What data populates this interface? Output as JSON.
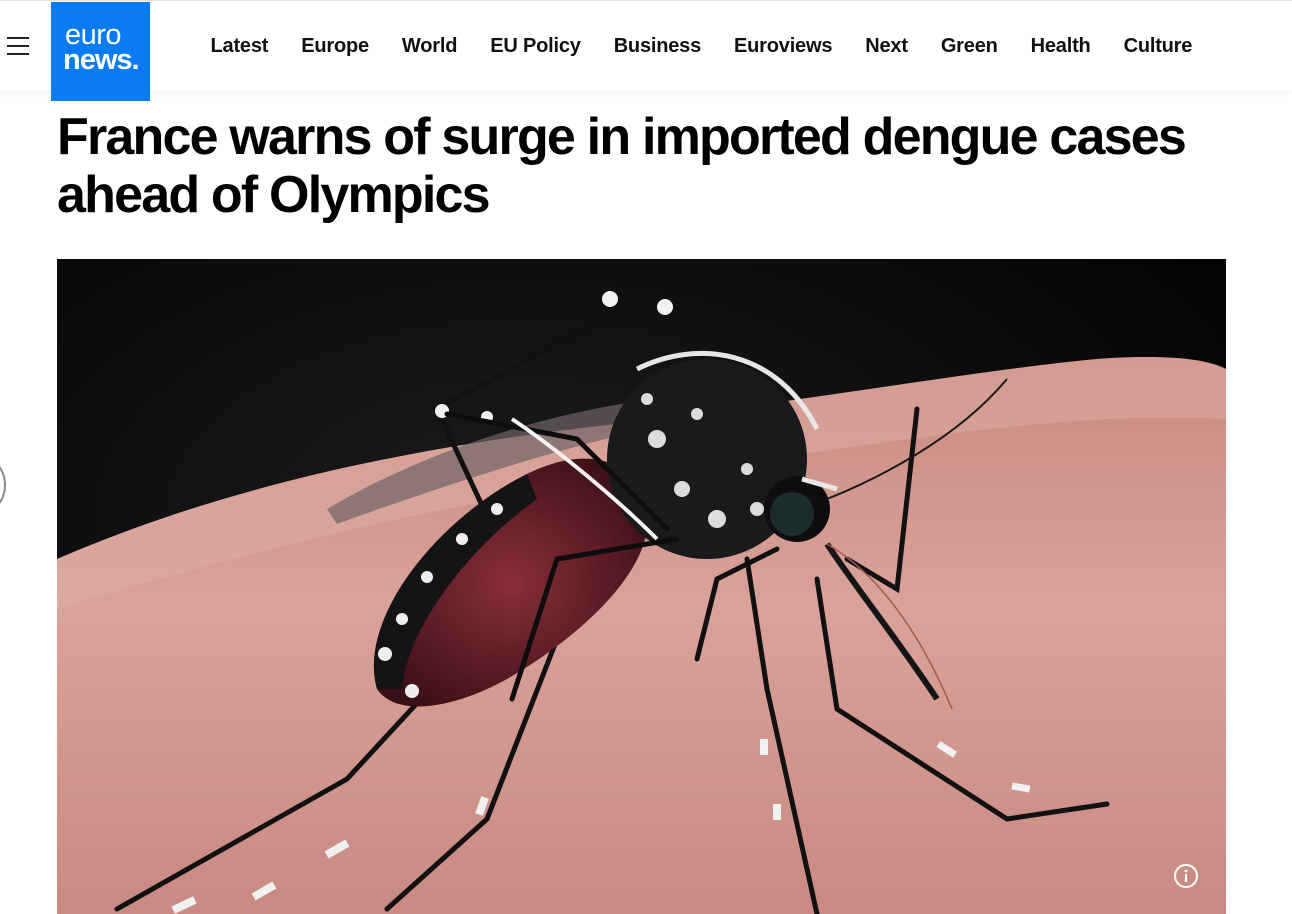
{
  "header": {
    "logo": {
      "line1": "euro",
      "line2": "news."
    },
    "menu_icon": "hamburger-icon",
    "nav": [
      "Latest",
      "Europe",
      "World",
      "EU Policy",
      "Business",
      "Euroviews",
      "Next",
      "Green",
      "Health",
      "Culture"
    ]
  },
  "article": {
    "headline": "France warns of surge in imported dengue cases ahead of Olympics"
  },
  "hero": {
    "info_icon": "info-icon"
  },
  "colors": {
    "brand": "#0b7bf1",
    "text": "#000000",
    "background": "#ffffff"
  }
}
